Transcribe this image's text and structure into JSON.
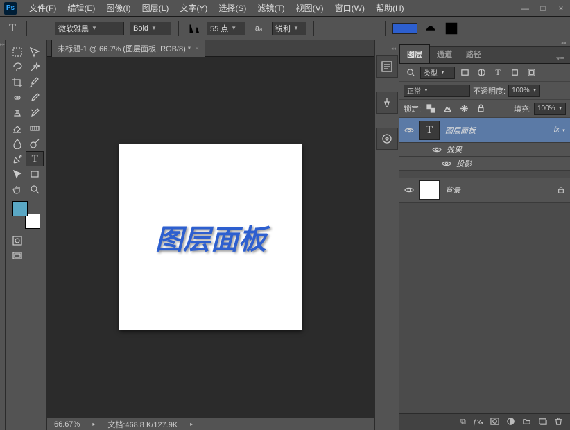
{
  "app": {
    "logo": "Ps"
  },
  "menu": [
    "文件(F)",
    "编辑(E)",
    "图像(I)",
    "图层(L)",
    "文字(Y)",
    "选择(S)",
    "滤镜(T)",
    "视图(V)",
    "窗口(W)",
    "帮助(H)"
  ],
  "options": {
    "tool_glyph": "T",
    "font_family": "微软雅黑",
    "font_style": "Bold",
    "font_size": "55 点",
    "aa_icon": "aₐ",
    "antialias": "锐利",
    "color": "#2d5fcf"
  },
  "document": {
    "tab_title": "未标题-1 @ 66.7% (图层面板, RGB/8) *",
    "canvas_text": "图层面板"
  },
  "status": {
    "zoom": "66.67%",
    "doc_info": "文档:468.8 K/127.9K"
  },
  "panels": {
    "tabs": {
      "layers": "图层",
      "channels": "通道",
      "paths": "路径"
    },
    "filter_label": "类型",
    "blend_mode": "正常",
    "opacity_label": "不透明度:",
    "opacity_value": "100%",
    "lock_label": "锁定:",
    "fill_label": "填充:",
    "fill_value": "100%",
    "layers": [
      {
        "name": "图层面板",
        "type": "text",
        "selected": true,
        "fx_label": "fx"
      },
      {
        "name": "效果",
        "sub": true
      },
      {
        "name": "投影",
        "sub": true,
        "indent": 2
      },
      {
        "name": "背景",
        "type": "raster",
        "locked": true
      }
    ]
  }
}
